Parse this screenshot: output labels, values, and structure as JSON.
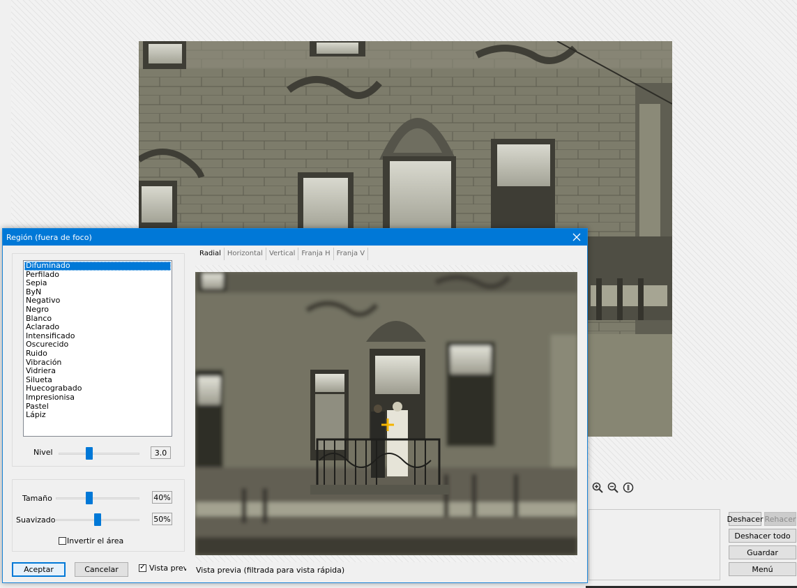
{
  "dialog": {
    "title": "Región (fuera de foco)",
    "effects": [
      "Difuminado",
      "Perfilado",
      "Sepia",
      "ByN",
      "Negativo",
      "Negro",
      "Blanco",
      "Aclarado",
      "Intensificado",
      "Oscurecido",
      "Ruido",
      "Vibración",
      "Vidriera",
      "Silueta",
      "Huecograbado",
      "Impresionisa",
      "Pastel",
      "Lápiz"
    ],
    "selected_effect": "Difuminado",
    "level_label": "Nivel",
    "level_value": "3.0",
    "size_label": "Tamaño",
    "size_value": "40%",
    "smooth_label": "Suavizado",
    "smooth_value": "50%",
    "invert_label": "Invertir el área",
    "invert_checked": false,
    "accept_label": "Aceptar",
    "cancel_label": "Cancelar",
    "preview_check_label": "Vista previa",
    "preview_checked": true,
    "tabs": [
      "Radial",
      "Horizontal",
      "Vertical",
      "Franja H",
      "Franja V"
    ],
    "active_tab": "Radial",
    "preview_caption": "Vista previa (filtrada para vista rápida)",
    "sliders": {
      "level_fraction": 0.38,
      "size_fraction": 0.4,
      "smooth_fraction": 0.5
    }
  },
  "main": {
    "buttons": {
      "undo": "Deshacer",
      "redo": "Rehacer",
      "undo_all": "Deshacer todo",
      "save": "Guardar",
      "menu": "Menú"
    },
    "zoom_icons": [
      "zoom-in-icon",
      "zoom-out-icon",
      "info-icon"
    ]
  },
  "colors": {
    "accent": "#0078d7",
    "photo_tone": "#7b7b6a"
  }
}
